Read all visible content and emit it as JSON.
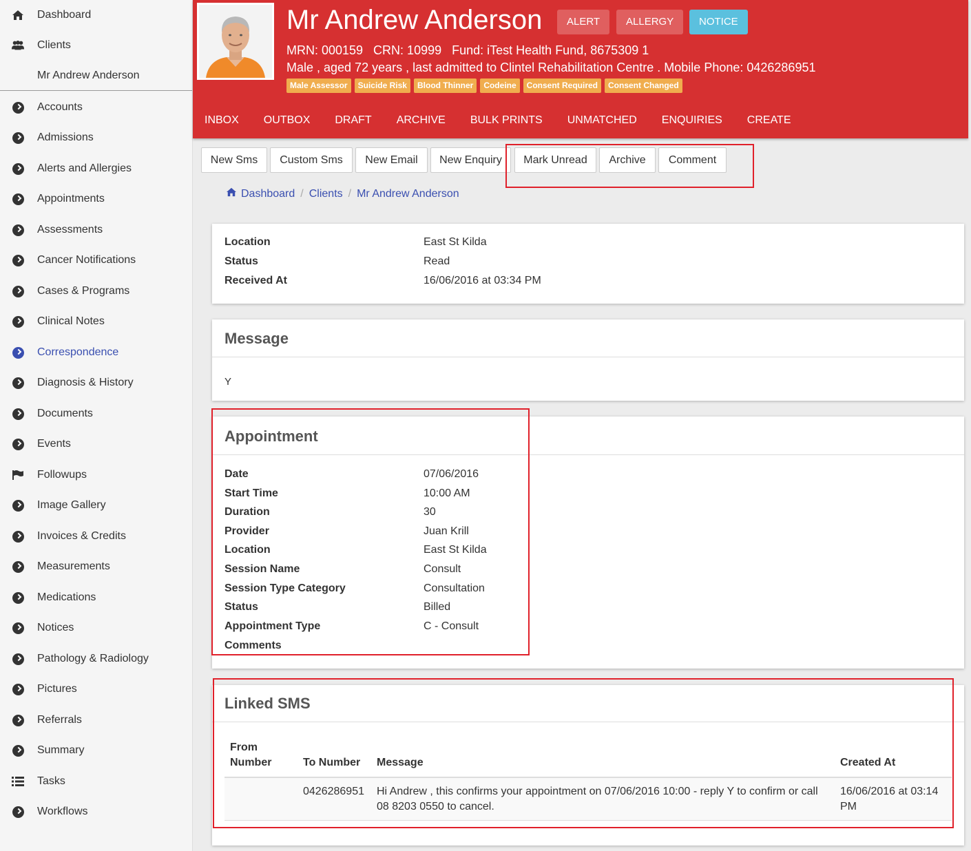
{
  "sidebar": {
    "items": [
      {
        "label": "Dashboard",
        "icon": "home-icon"
      },
      {
        "label": "Clients",
        "icon": "users-icon"
      },
      {
        "label": "Mr Andrew Anderson",
        "icon": "user-icon"
      },
      {
        "label": "Accounts",
        "icon": "chevron-circle-icon"
      },
      {
        "label": "Admissions",
        "icon": "chevron-circle-icon"
      },
      {
        "label": "Alerts and Allergies",
        "icon": "chevron-circle-icon"
      },
      {
        "label": "Appointments",
        "icon": "chevron-circle-icon"
      },
      {
        "label": "Assessments",
        "icon": "chevron-circle-icon"
      },
      {
        "label": "Cancer Notifications",
        "icon": "chevron-circle-icon"
      },
      {
        "label": "Cases & Programs",
        "icon": "chevron-circle-icon"
      },
      {
        "label": "Clinical Notes",
        "icon": "chevron-circle-icon"
      },
      {
        "label": "Correspondence",
        "icon": "chevron-circle-icon"
      },
      {
        "label": "Diagnosis & History",
        "icon": "chevron-circle-icon"
      },
      {
        "label": "Documents",
        "icon": "chevron-circle-icon"
      },
      {
        "label": "Events",
        "icon": "chevron-circle-icon"
      },
      {
        "label": "Followups",
        "icon": "flag-icon"
      },
      {
        "label": "Image Gallery",
        "icon": "chevron-circle-icon"
      },
      {
        "label": "Invoices & Credits",
        "icon": "chevron-circle-icon"
      },
      {
        "label": "Measurements",
        "icon": "chevron-circle-icon"
      },
      {
        "label": "Medications",
        "icon": "chevron-circle-icon"
      },
      {
        "label": "Notices",
        "icon": "chevron-circle-icon"
      },
      {
        "label": "Pathology & Radiology",
        "icon": "chevron-circle-icon"
      },
      {
        "label": "Pictures",
        "icon": "chevron-circle-icon"
      },
      {
        "label": "Referrals",
        "icon": "chevron-circle-icon"
      },
      {
        "label": "Summary",
        "icon": "chevron-circle-icon"
      },
      {
        "label": "Tasks",
        "icon": "list-icon"
      },
      {
        "label": "Workflows",
        "icon": "chevron-circle-icon"
      }
    ],
    "active_item": "Correspondence"
  },
  "header": {
    "name": "Mr Andrew Anderson",
    "buttons": {
      "alert": "ALERT",
      "allergy": "ALLERGY",
      "notice": "NOTICE"
    },
    "line1": "MRN: 000159   CRN: 10999   Fund: iTest Health Fund, 8675309 1",
    "line2": "Male , aged 72 years , last admitted to Clintel Rehabilitation Centre . Mobile Phone: 0426286951",
    "tags": [
      "Male Assessor",
      "Suicide Risk",
      "Blood Thinner",
      "Codeine",
      "Consent Required",
      "Consent Changed"
    ],
    "tabs": [
      "INBOX",
      "OUTBOX",
      "DRAFT",
      "ARCHIVE",
      "BULK PRINTS",
      "UNMATCHED",
      "ENQUIRIES",
      "CREATE"
    ]
  },
  "toolbar": {
    "new_sms": "New Sms",
    "custom_sms": "Custom Sms",
    "new_email": "New Email",
    "new_enquiry": "New Enquiry",
    "mark_unread": "Mark Unread",
    "archive": "Archive",
    "comment": "Comment"
  },
  "breadcrumb": {
    "items": [
      "Dashboard",
      "Clients",
      "Mr Andrew Anderson"
    ],
    "separator": "/"
  },
  "details": {
    "rows": [
      {
        "key": "Location",
        "value": "East St Kilda"
      },
      {
        "key": "Status",
        "value": "Read"
      },
      {
        "key": "Received At",
        "value": "16/06/2016 at 03:34 PM"
      }
    ]
  },
  "message": {
    "title": "Message",
    "body": "Y"
  },
  "appointment": {
    "title": "Appointment",
    "rows": [
      {
        "key": "Date",
        "value": "07/06/2016"
      },
      {
        "key": "Start Time",
        "value": "10:00 AM"
      },
      {
        "key": "Duration",
        "value": "30"
      },
      {
        "key": "Provider",
        "value": "Juan Krill"
      },
      {
        "key": "Location",
        "value": "East St Kilda"
      },
      {
        "key": "Session Name",
        "value": "Consult"
      },
      {
        "key": "Session Type Category",
        "value": "Consultation"
      },
      {
        "key": "Status",
        "value": "Billed"
      },
      {
        "key": "Appointment Type",
        "value": "C - Consult"
      },
      {
        "key": "Comments",
        "value": ""
      }
    ]
  },
  "linked_sms": {
    "title": "Linked SMS",
    "columns": {
      "from_line1": "From",
      "from_line2": "Number",
      "to": "To Number",
      "message": "Message",
      "created": "Created At"
    },
    "rows": [
      {
        "from": "",
        "to": "0426286951",
        "message_line1": "Hi Andrew , this confirms your appointment on 07/06/2016 10:00 - reply Y to confirm or call",
        "message_line2": "08 8203 0550 to cancel.",
        "created_line1": "16/06/2016 at 03:14",
        "created_line2": "PM"
      }
    ]
  },
  "colors": {
    "header_red": "#d63031",
    "tag_orange": "#f0ad4e",
    "notice_blue": "#5bc0de",
    "link_blue": "#3a4fb0",
    "highlight_red": "#e0202a"
  }
}
